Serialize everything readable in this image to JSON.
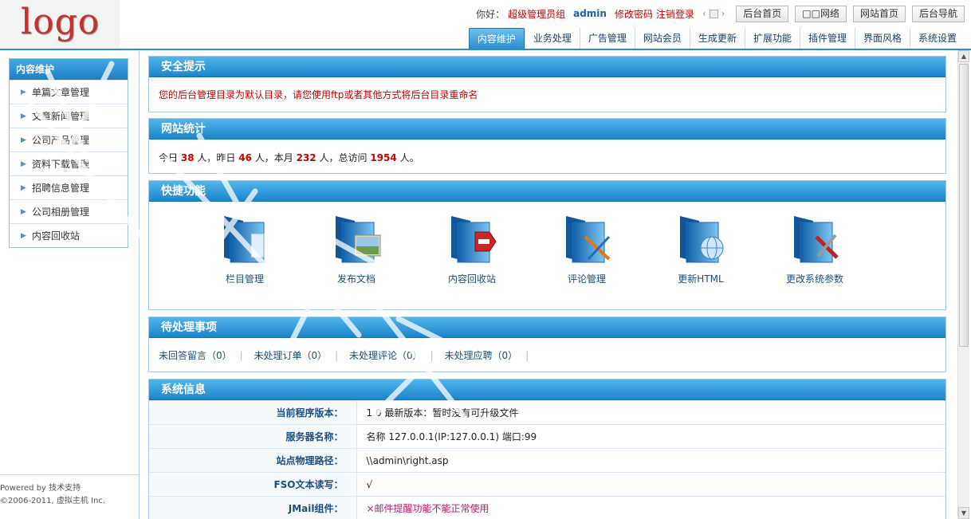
{
  "logo": {
    "text": "logo"
  },
  "topbar": {
    "greeting": "你好：",
    "group": "超级管理员组",
    "user": "admin",
    "change_password": "修改密码",
    "logout": "注销登录",
    "buttons": [
      "后台首页",
      "□□网络",
      "网站首页",
      "后台导航"
    ]
  },
  "tabs": [
    "内容维护",
    "业务处理",
    "广告管理",
    "网站会员",
    "生成更新",
    "扩展功能",
    "插件管理",
    "界面风格",
    "系统设置"
  ],
  "sidebar": {
    "title": "内容维护",
    "items": [
      "单篇文章管理",
      "文章新闻管理",
      "公司产品管理",
      "资料下载管理",
      "招聘信息管理",
      "公司相册管理",
      "内容回收站"
    ],
    "powered": "Powered by 技术支持",
    "copyright": "©2006-2011, 虚拟主机 Inc."
  },
  "security": {
    "title": "安全提示",
    "message": "您的后台管理目录为默认目录，请您使用ftp或者其他方式将后台目录重命名"
  },
  "stats": {
    "title": "网站统计",
    "today_label": "今日",
    "today": "38",
    "unit1": "人，昨日",
    "yesterday": "46",
    "unit2": "人，本月",
    "month": "232",
    "unit3": "人，总访问",
    "total": "1954",
    "unit4": "人。"
  },
  "quick": {
    "title": "快捷功能",
    "items": [
      "栏目管理",
      "发布文档",
      "内容回收站",
      "评论管理",
      "更新HTML",
      "更改系统参数"
    ]
  },
  "pending": {
    "title": "待处理事项",
    "items": [
      "未回答留言（0）",
      "未处理订单（0）",
      "未处理评论（0）",
      "未处理应聘（0）"
    ]
  },
  "sysinfo": {
    "title": "系统信息",
    "rows": [
      {
        "key": "当前程序版本：",
        "value": "1.0 最新版本：暂时没有可升级文件"
      },
      {
        "key": "服务器名称：",
        "value": "名称 127.0.0.1(IP:127.0.0.1) 端口:99"
      },
      {
        "key": "站点物理路径：",
        "value": "\\\\admin\\right.asp"
      },
      {
        "key": "FSO文本读写：",
        "value": "√"
      },
      {
        "key": "JMail组件：",
        "value": "×邮件提醒功能不能正常使用"
      }
    ]
  },
  "colors": {
    "accent": "#2d8dcd",
    "warning": "#cc0000",
    "link": "#1b4f80"
  }
}
